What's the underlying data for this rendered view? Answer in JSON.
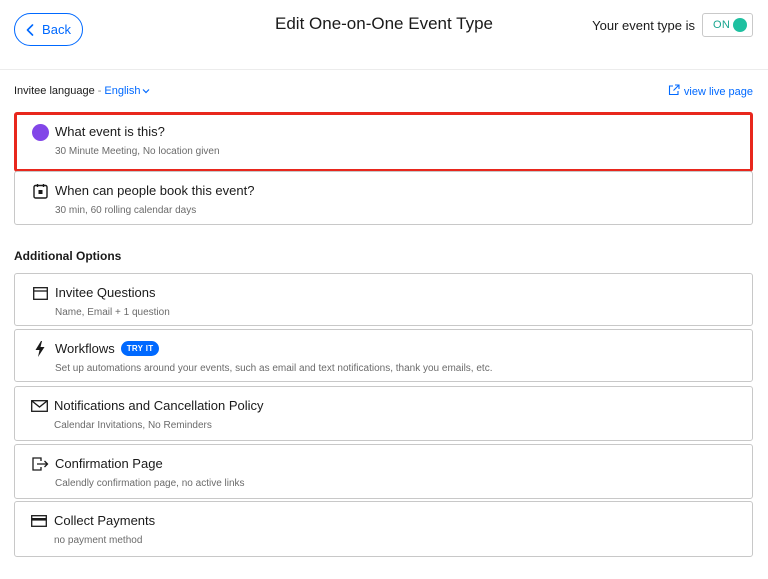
{
  "header": {
    "back_label": "Back",
    "title": "Edit One-on-One Event Type",
    "status_label": "Your event type is",
    "toggle_label": "ON"
  },
  "language": {
    "label": "Invitee language",
    "separator": "-",
    "value": "English"
  },
  "live_link": "view live page",
  "main_cards": [
    {
      "title": "What event is this?",
      "subtitle": "30 Minute Meeting, No location given",
      "icon": "purple-dot-icon"
    },
    {
      "title": "When can people book this event?",
      "subtitle": "30 min, 60 rolling calendar days",
      "icon": "calendar-icon"
    }
  ],
  "additional": {
    "heading": "Additional Options",
    "items": [
      {
        "title": "Invitee Questions",
        "subtitle": "Name, Email + 1 question",
        "icon": "form-icon"
      },
      {
        "title": "Workflows",
        "badge": "TRY IT",
        "subtitle": "Set up automations around your events, such as email and text notifications, thank you emails, etc.",
        "icon": "lightning-icon"
      },
      {
        "title": "Notifications and Cancellation Policy",
        "subtitle": "Calendar Invitations, No Reminders",
        "icon": "envelope-icon"
      },
      {
        "title": "Confirmation Page",
        "subtitle": "Calendly confirmation page, no active links",
        "icon": "exit-icon"
      },
      {
        "title": "Collect Payments",
        "subtitle": "no payment method",
        "icon": "credit-card-icon"
      }
    ]
  },
  "colors": {
    "accent": "#0069ff",
    "event_color": "#8246e8",
    "toggle_on": "#1ec0a0",
    "highlight": "#e8271d"
  }
}
